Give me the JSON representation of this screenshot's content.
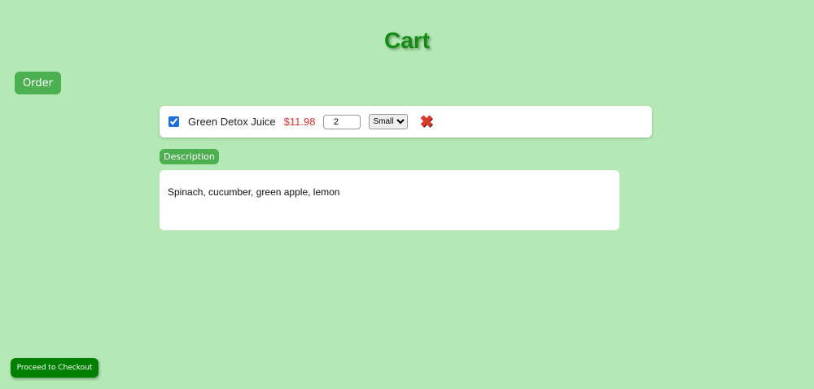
{
  "header": {
    "title": "Cart"
  },
  "nav": {
    "order_label": "Order"
  },
  "cart": {
    "items": [
      {
        "checked": true,
        "name": "Green Detox Juice",
        "price": "$11.98",
        "quantity": "2",
        "size": "Small",
        "remove_icon": "x-mark-icon"
      }
    ]
  },
  "description": {
    "toggle_label": "Description",
    "text": "Spinach, cucumber, green apple, lemon"
  },
  "footer": {
    "checkout_label": "Proceed to Checkout"
  },
  "colors": {
    "accent": "#4caf50",
    "checkout": "#008000",
    "price": "#e53030",
    "background": "#b4e8b4"
  }
}
